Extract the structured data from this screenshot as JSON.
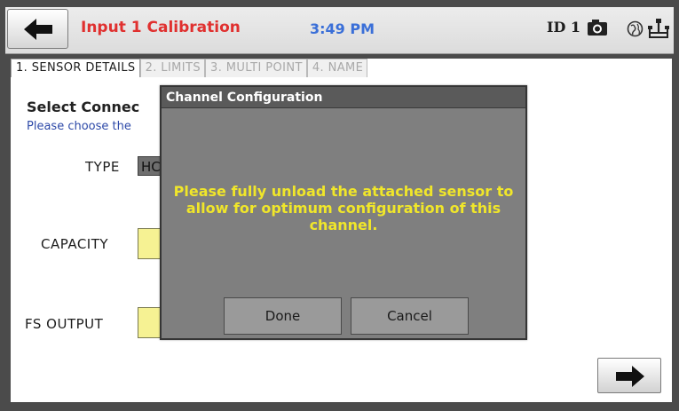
{
  "header": {
    "title": "Input 1 Calibration",
    "time": "3:49 PM",
    "device_id": "ID 1",
    "icons": [
      "back-arrow-icon",
      "camera-icon",
      "globe-icon",
      "usb-icon"
    ]
  },
  "tabs": [
    {
      "label": "1. SENSOR DETAILS",
      "active": true
    },
    {
      "label": "2. LIMITS",
      "active": false
    },
    {
      "label": "3. MULTI POINT",
      "active": false
    },
    {
      "label": "4. NAME",
      "active": false
    }
  ],
  "section": {
    "title": "Select Connec",
    "subtitle": "Please choose the"
  },
  "fields": {
    "type_label": "TYPE",
    "type_value": "HC",
    "capacity_label": "CAPACITY",
    "fs_output_label": "FS OUTPUT"
  },
  "dialog": {
    "title": "Channel Configuration",
    "message": "Please fully unload the attached sensor to allow for optimum configuration of this channel.",
    "done_label": "Done",
    "cancel_label": "Cancel"
  },
  "colors": {
    "title": "#e0302f",
    "time": "#3a6fd8",
    "dialog_message": "#f0e62a",
    "input_fill": "#f6f293"
  }
}
